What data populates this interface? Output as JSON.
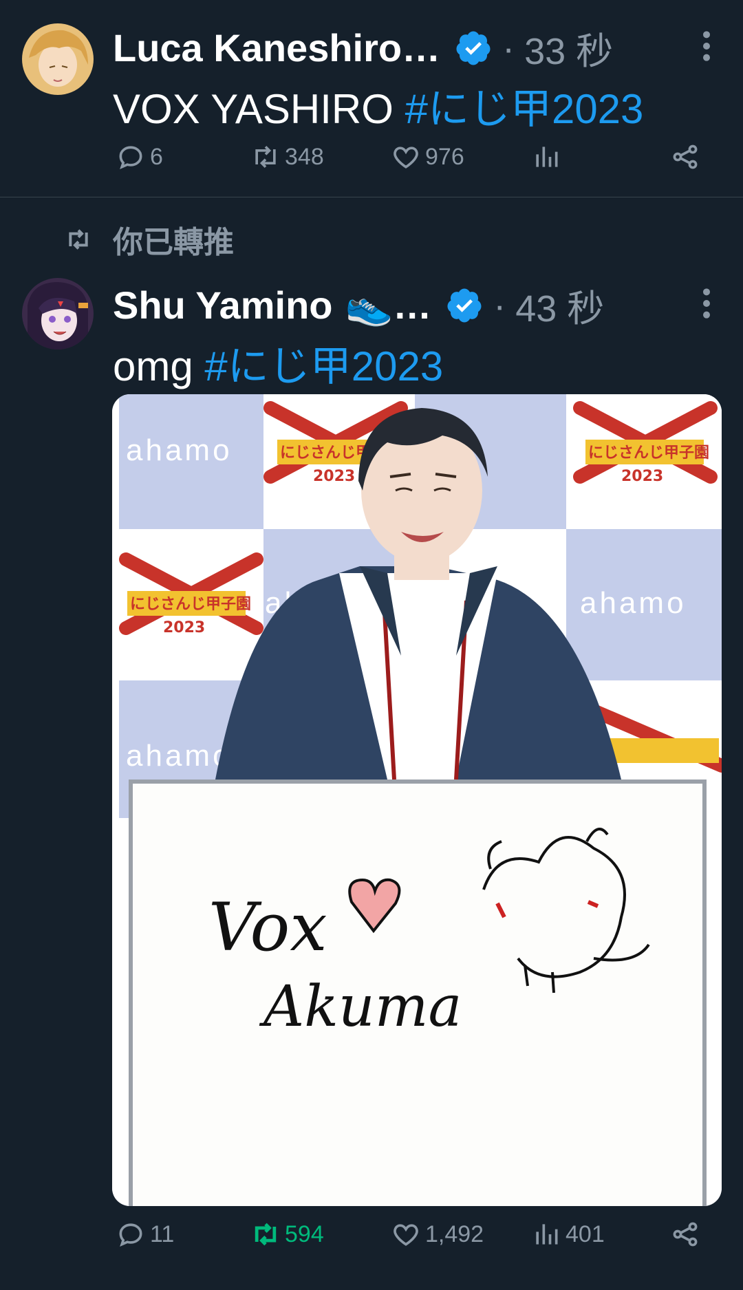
{
  "tweets": [
    {
      "author": "Luca Kaneshiro…",
      "separator": "·",
      "time": "33 秒",
      "text": "VOX YASHIRO",
      "hashtag": "#にじ甲2023",
      "replies": "6",
      "retweets": "348",
      "likes": "976",
      "views": ""
    },
    {
      "retweet_label": "你已轉推",
      "author": "Shu Yamino",
      "author_emoji": "👟",
      "author_ellipsis": "…",
      "separator": "·",
      "time": "43 秒",
      "text": "omg",
      "hashtag": "#にじ甲2023",
      "replies": "11",
      "retweets": "594",
      "likes": "1,492",
      "views": "401"
    }
  ],
  "media": {
    "backdrop_logo_text": "ahamo",
    "backdrop_badge_text": "にじさんじ甲子園",
    "backdrop_badge_year": "2023",
    "board_line1": "Vox",
    "board_line2": "Akuma"
  },
  "colors": {
    "background": "#15202b",
    "hashtag": "#1d9bf0",
    "muted": "#8b98a5",
    "retweeted": "#00ba7c",
    "verified": "#1d9bf0"
  },
  "icons": [
    "verified-icon",
    "more-icon",
    "reply-icon",
    "retweet-icon",
    "like-icon",
    "views-icon",
    "share-icon"
  ]
}
